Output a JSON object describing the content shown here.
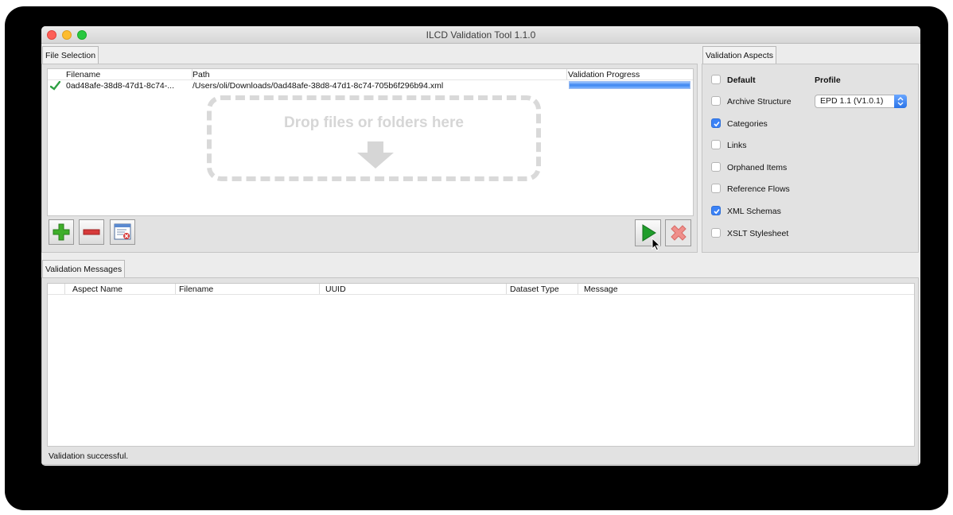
{
  "window": {
    "title": "ILCD Validation Tool 1.1.0"
  },
  "file_selection": {
    "tab_label": "File Selection",
    "columns": {
      "filename": "Filename",
      "path": "Path",
      "progress": "Validation Progress"
    },
    "rows": [
      {
        "status_icon": "check-icon",
        "filename": "0ad48afe-38d8-47d1-8c74-...",
        "path": "/Users/oli/Downloads/0ad48afe-38d8-47d1-8c74-705b6f296b94.xml",
        "progress": 1.0
      }
    ],
    "drop_hint": "Drop files or folders here",
    "toolbar": {
      "add_icon": "plus-icon",
      "remove_icon": "minus-icon",
      "clear_icon": "clear-list-icon",
      "run_icon": "play-icon",
      "stop_icon": "cancel-x-icon"
    }
  },
  "validation_aspects": {
    "tab_label": "Validation Aspects",
    "default_label": "Default",
    "profile_label": "Profile",
    "profile_value": "EPD 1.1 (V1.0.1)",
    "items": [
      {
        "label": "Archive Structure",
        "checked": false
      },
      {
        "label": "Categories",
        "checked": true
      },
      {
        "label": "Links",
        "checked": false
      },
      {
        "label": "Orphaned Items",
        "checked": false
      },
      {
        "label": "Reference Flows",
        "checked": false
      },
      {
        "label": "XML Schemas",
        "checked": true
      },
      {
        "label": "XSLT Stylesheet",
        "checked": false
      }
    ]
  },
  "validation_messages": {
    "tab_label": "Validation Messages",
    "columns": {
      "aspect": "Aspect Name",
      "filename": "Filename",
      "uuid": "UUID",
      "dataset_type": "Dataset Type",
      "message": "Message"
    },
    "status_text": "Validation successful."
  },
  "colors": {
    "accent": "#3b82f6",
    "run": "#1f9d2b",
    "stop": "#e0524d",
    "add": "#3fae2a",
    "remove": "#d73a3a"
  }
}
